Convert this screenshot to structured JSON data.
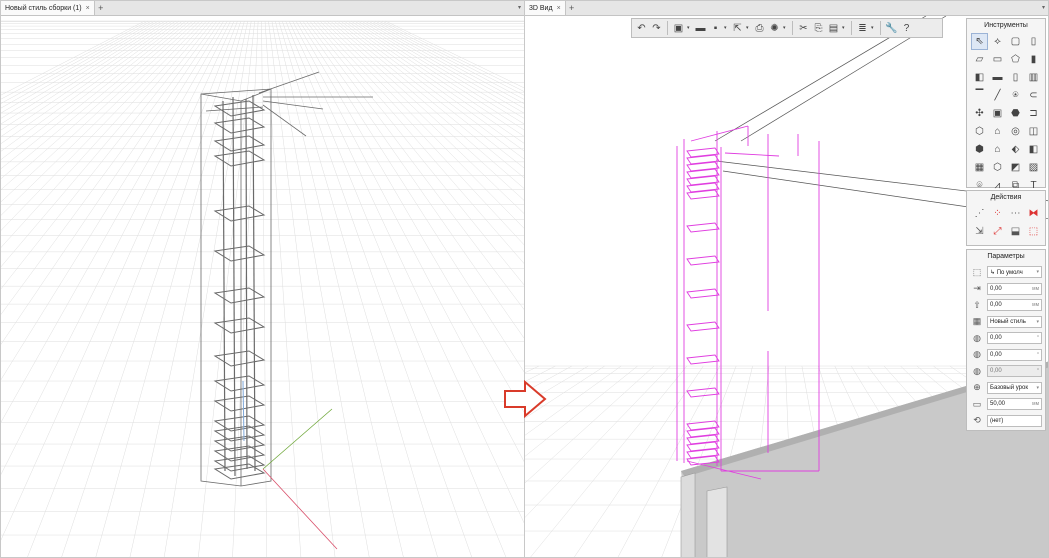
{
  "left_tabs": {
    "tab1_label": "Новый стиль сборки (1)",
    "tab1_close": "×",
    "add": "+",
    "menu": "▾"
  },
  "right_tabs": {
    "tab1_label": "3D Вид",
    "tab1_close": "×",
    "add": "+",
    "menu": "▾"
  },
  "toolbar": {
    "icons": [
      "undo-icon",
      "redo-icon",
      "object-icon",
      "open-folder-icon",
      "save-icon",
      "export-icon",
      "print-icon",
      "render-icon",
      "cut-icon",
      "copy-icon",
      "paste-icon",
      "layers-icon",
      "wrench-icon",
      "help-icon"
    ],
    "glyphs": [
      "↶",
      "↷",
      "▣",
      "▬",
      "▪",
      "⇱",
      "⎙",
      "✺",
      "✂",
      "⎘",
      "▤",
      "≣",
      "🔧",
      "?"
    ]
  },
  "tools_panel": {
    "title": "Инструменты",
    "glyphs": [
      "⇖",
      "⟡",
      "▢",
      "▯",
      "▱",
      "▭",
      "⬠",
      "▮",
      "◧",
      "▬",
      "▯",
      "▥",
      "▔",
      "╱",
      "⍟",
      "⊂",
      "✣",
      "▣",
      "⬣",
      "⊐",
      "⬡",
      "⌂",
      "◎",
      "◫",
      "⬢",
      "⌂",
      "⬖",
      "◧",
      "▦",
      "⬡",
      "◩",
      "▨",
      "⌾",
      "⩘",
      "⧉",
      "T"
    ]
  },
  "actions_panel": {
    "title": "Действия",
    "glyphs": [
      "⋰",
      "⁘",
      "⋯",
      "⧓",
      "⇲",
      "⤢",
      "⬓",
      "⬚"
    ]
  },
  "params_panel": {
    "title": "Параметры",
    "rows": [
      {
        "icon": "⬚",
        "value": "↳ По умолч",
        "unit": "▾",
        "disabled": false
      },
      {
        "icon": "⇥",
        "value": "0,00",
        "unit": "мм",
        "disabled": false
      },
      {
        "icon": "⇧",
        "value": "0,00",
        "unit": "мм",
        "disabled": false
      },
      {
        "icon": "▦",
        "value": "Новый стиль",
        "unit": "▾",
        "disabled": false
      },
      {
        "icon": "◍",
        "value": "0,00",
        "unit": "°",
        "disabled": false
      },
      {
        "icon": "◍",
        "value": "0,00",
        "unit": "°",
        "disabled": false
      },
      {
        "icon": "◍",
        "value": "0,00",
        "unit": "°",
        "disabled": true
      },
      {
        "icon": "⊕",
        "value": "Базовый урок",
        "unit": "▾",
        "disabled": false
      },
      {
        "icon": "▭",
        "value": "50,00",
        "unit": "мм",
        "disabled": false
      },
      {
        "icon": "⟲",
        "value": "(нет)",
        "unit": "",
        "disabled": false
      }
    ]
  },
  "colors": {
    "rebar_magenta": "#e03ee0",
    "wire_gray": "#6a6a6a",
    "axis_green": "#6fa83a",
    "axis_red": "#d94f6a",
    "arrow_red": "#d93b2a",
    "grid": "#dcdcdc"
  }
}
